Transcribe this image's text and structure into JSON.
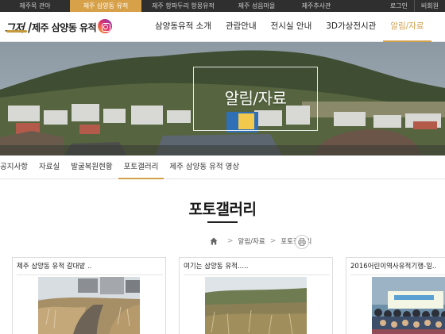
{
  "topbar": {
    "sites": [
      "제주목 관아",
      "제주 삼양동 유적",
      "제주 항파두리 항몽유적",
      "제주 성읍마을",
      "제주추사관"
    ],
    "active_index": 1,
    "login": "로그인",
    "signup": "비회원"
  },
  "header": {
    "logo_mark": "그저ㅣ",
    "logo_text": "제주 삼양동 유적",
    "nav": [
      "삼양동유적 소개",
      "관람안내",
      "전시실 안내",
      "3D가상전시관",
      "알림/자료"
    ],
    "nav_active_index": 4
  },
  "banner": {
    "title": "알림/자료"
  },
  "subnav": {
    "items": [
      "공지사항",
      "자료실",
      "발굴복원현황",
      "포토갤러리",
      "제주 삼양동 유적 영상"
    ],
    "active_index": 3
  },
  "page": {
    "title": "포토갤러리"
  },
  "breadcrumb": {
    "level1": "알림/자료",
    "level2": "포토갤러리"
  },
  "gallery": [
    {
      "title": "제주 삼양동 유적 갈대밭 ..",
      "image": "pampas-grass-path-photo"
    },
    {
      "title": "여기는 삼양동 유적.....",
      "image": "pampas-grass-field-photo"
    },
    {
      "title": "2016어린이역사유적기행-일..",
      "image": "children-group-photo"
    }
  ],
  "colors": {
    "accent": "#d3a04c",
    "topbar_bg": "#2f2f2f"
  },
  "icons": [
    "home-icon",
    "print-icon",
    "instagram-icon"
  ]
}
